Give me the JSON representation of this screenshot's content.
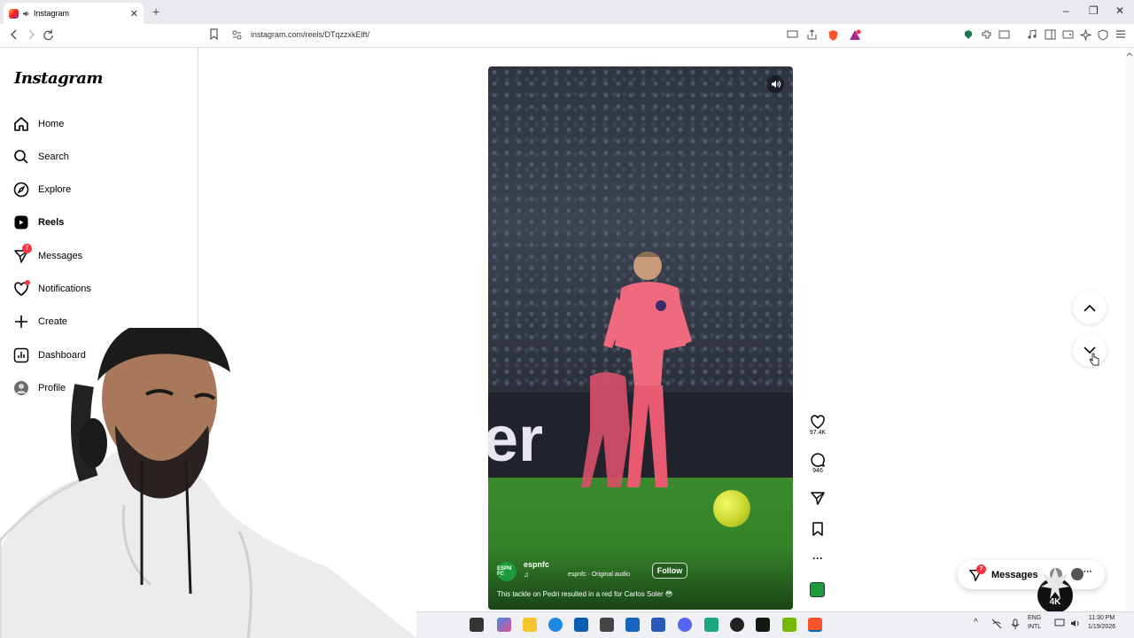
{
  "browser": {
    "tab_title": "Instagram",
    "url": "instagram.com/reels/DTqzzxkElft/",
    "new_tab": "+",
    "close": "✕"
  },
  "sidebar": {
    "logo": "Instagram",
    "items": [
      {
        "label": "Home",
        "icon": "home-icon"
      },
      {
        "label": "Search",
        "icon": "search-icon"
      },
      {
        "label": "Explore",
        "icon": "compass-icon"
      },
      {
        "label": "Reels",
        "icon": "reels-icon"
      },
      {
        "label": "Messages",
        "icon": "send-icon",
        "badge": "7"
      },
      {
        "label": "Notifications",
        "icon": "heart-icon"
      },
      {
        "label": "Create",
        "icon": "plus-icon"
      },
      {
        "label": "Dashboard",
        "icon": "chart-icon"
      },
      {
        "label": "Profile",
        "icon": "avatar"
      }
    ]
  },
  "reel": {
    "account": "espnfc",
    "avatar_text": "ESPN FC",
    "audio": "espnfc · Original audio",
    "follow": "Follow",
    "caption": "This tackle on Pedri resulted in a red for Carlos Soler 😳",
    "board_text": "er",
    "note_symbol": "♫"
  },
  "actions": {
    "likes": "97.4K",
    "comments": "946",
    "more": "···"
  },
  "messages": {
    "label": "Messages",
    "badge": "7",
    "more": "···"
  },
  "taskbar": {
    "lang_top": "ENG",
    "lang_bottom": "INTL",
    "time": "11:30 PM",
    "date": "1/19/2026"
  },
  "colors": {
    "instagram_red": "#ff3040",
    "pitch_green": "#3b8a2d",
    "kit_pink": "#f06a7e"
  }
}
